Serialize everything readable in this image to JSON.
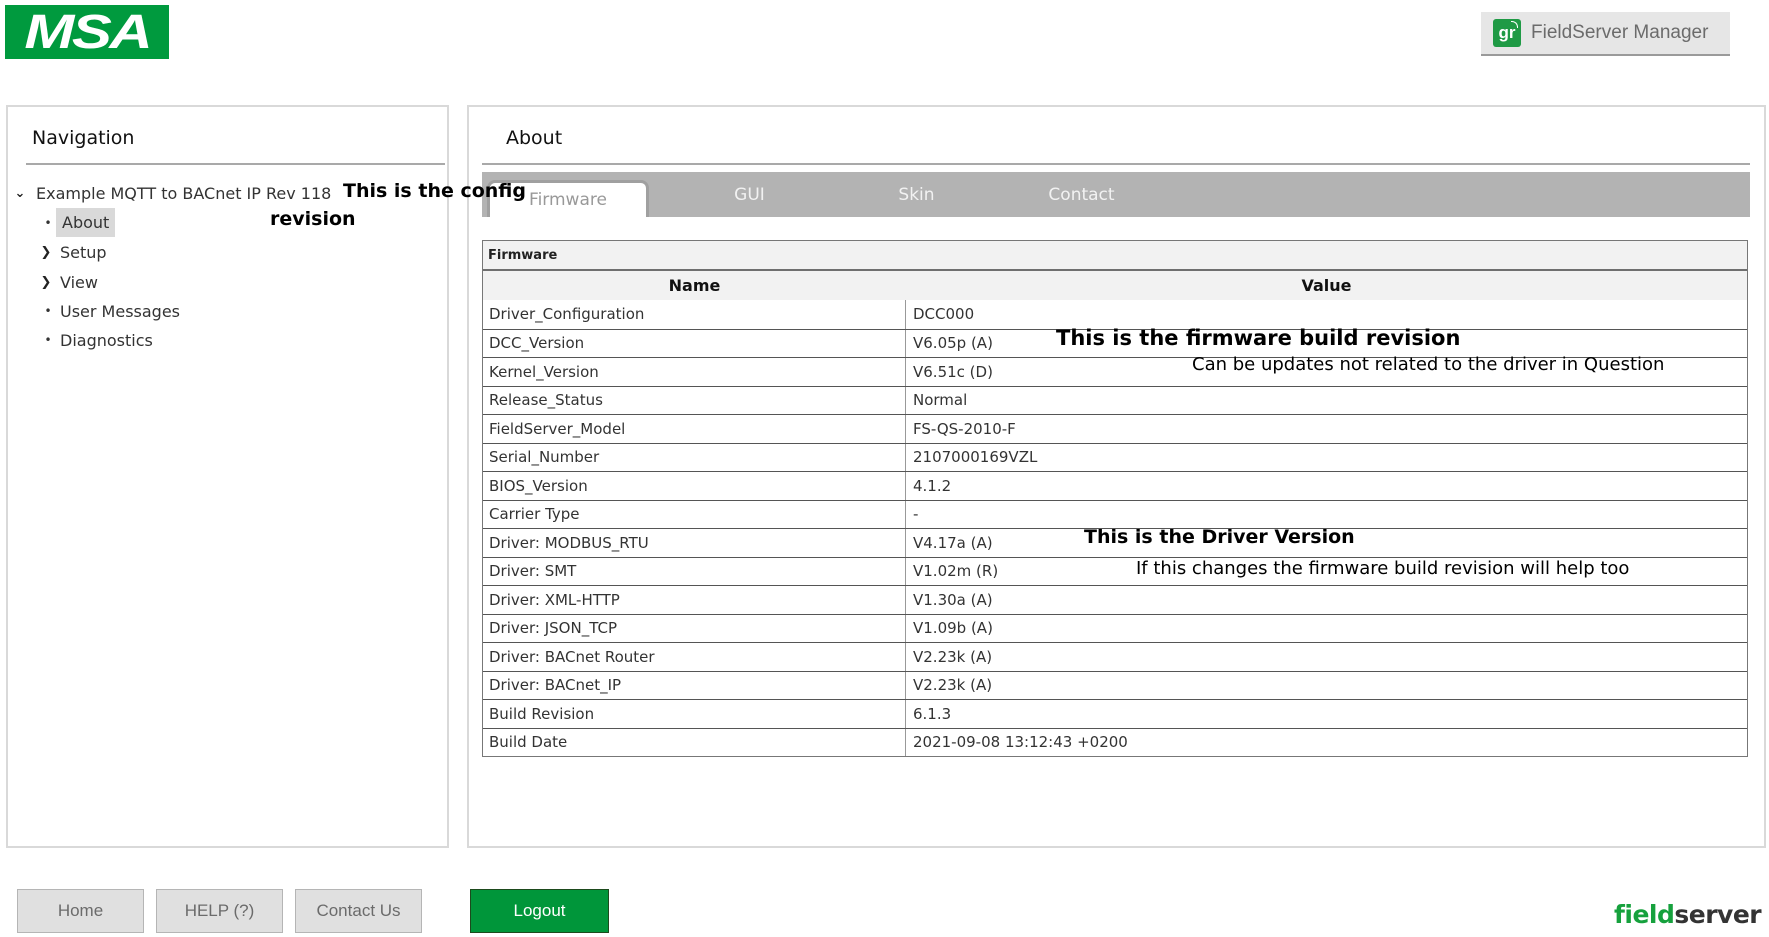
{
  "header": {
    "brand_logo_text": "MSA",
    "manager_button": {
      "icon": "gr",
      "label": "FieldServer Manager"
    }
  },
  "navigation": {
    "title": "Navigation",
    "root": {
      "label": "Example MQTT to BACnet IP Rev 118",
      "expanded": true,
      "icon": "chevron-down-icon"
    },
    "items": [
      {
        "label": "About",
        "type": "leaf",
        "selected": true
      },
      {
        "label": "Setup",
        "type": "branch",
        "expanded": false
      },
      {
        "label": "View",
        "type": "branch",
        "expanded": false
      },
      {
        "label": "User Messages",
        "type": "leaf"
      },
      {
        "label": "Diagnostics",
        "type": "leaf"
      }
    ]
  },
  "main": {
    "title": "About",
    "tabs": [
      {
        "label": "Firmware",
        "active": true
      },
      {
        "label": "GUI",
        "active": false
      },
      {
        "label": "Skin",
        "active": false
      },
      {
        "label": "Contact",
        "active": false
      }
    ],
    "firmware_table": {
      "caption": "Firmware",
      "columns": [
        "Name",
        "Value"
      ],
      "rows": [
        {
          "name": "Driver_Configuration",
          "value": "DCC000"
        },
        {
          "name": "DCC_Version",
          "value": "V6.05p (A)"
        },
        {
          "name": "Kernel_Version",
          "value": "V6.51c (D)"
        },
        {
          "name": "Release_Status",
          "value": "Normal"
        },
        {
          "name": "FieldServer_Model",
          "value": "FS-QS-2010-F"
        },
        {
          "name": "Serial_Number",
          "value": "2107000169VZL"
        },
        {
          "name": "BIOS_Version",
          "value": "4.1.2"
        },
        {
          "name": "Carrier Type",
          "value": "-"
        },
        {
          "name": "Driver: MODBUS_RTU",
          "value": "V4.17a (A)"
        },
        {
          "name": "Driver: SMT",
          "value": "V1.02m (R)"
        },
        {
          "name": "Driver: XML-HTTP",
          "value": "V1.30a (A)"
        },
        {
          "name": "Driver: JSON_TCP",
          "value": "V1.09b (A)"
        },
        {
          "name": "Driver: BACnet Router",
          "value": "V2.23k (A)"
        },
        {
          "name": "Driver: BACnet_IP",
          "value": "V2.23k (A)"
        },
        {
          "name": "Build Revision",
          "value": "6.1.3"
        },
        {
          "name": "Build Date",
          "value": "2021-09-08 13:12:43 +0200"
        }
      ]
    }
  },
  "annotations": {
    "config_line1": "This is the config",
    "config_line2": "revision",
    "firmware_build": "This is the firmware build revision",
    "firmware_note": "Can be updates not related to the driver in Question",
    "driver_version": "This is the Driver Version",
    "driver_note": "If this changes the firmware build revision will help too"
  },
  "footer": {
    "buttons": {
      "home": "Home",
      "help": "HELP (?)",
      "contact": "Contact Us",
      "logout": "Logout"
    },
    "logo": {
      "part1": "field",
      "part2": "server"
    }
  },
  "colors": {
    "brand_green": "#009a3e",
    "logout_green": "#00963a",
    "tab_bar_gray": "#b3b3b3"
  }
}
